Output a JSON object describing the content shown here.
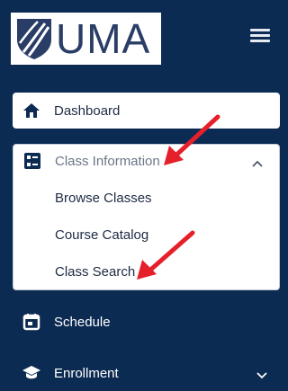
{
  "logo": {
    "text": "UMA"
  },
  "nav": {
    "dashboard": "Dashboard",
    "class_information": "Class Information",
    "class_information_items": [
      "Browse Classes",
      "Course Catalog",
      "Class Search"
    ],
    "schedule": "Schedule",
    "enrollment": "Enrollment"
  },
  "colors": {
    "sidebar_bg": "#0b2b52",
    "annotation_arrow": "#e5202a"
  },
  "icons": [
    "hamburger-menu-icon",
    "home-icon",
    "list-icon",
    "calendar-icon",
    "graduation-cap-icon",
    "chevron-up-icon",
    "chevron-down-icon"
  ]
}
